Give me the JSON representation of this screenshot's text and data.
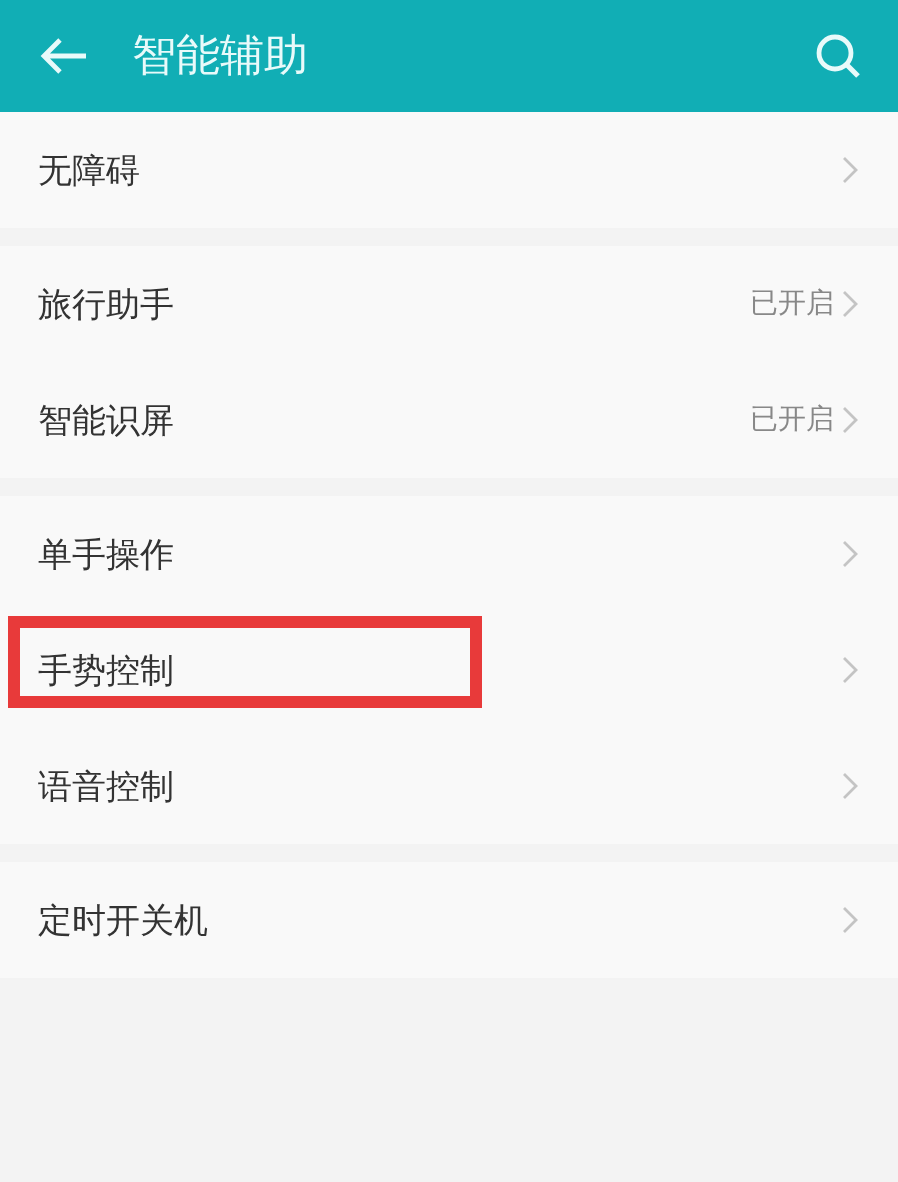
{
  "header": {
    "title": "智能辅助"
  },
  "groups": [
    {
      "items": [
        {
          "label": "无障碍",
          "highlighted": false
        }
      ]
    },
    {
      "items": [
        {
          "label": "旅行助手",
          "status": "已开启",
          "highlighted": false
        },
        {
          "label": "智能识屏",
          "status": "已开启",
          "highlighted": false
        }
      ]
    },
    {
      "items": [
        {
          "label": "单手操作",
          "highlighted": false
        },
        {
          "label": "手势控制",
          "highlighted": true
        },
        {
          "label": "语音控制",
          "highlighted": false
        }
      ]
    },
    {
      "items": [
        {
          "label": "定时开关机",
          "highlighted": false
        }
      ]
    }
  ]
}
